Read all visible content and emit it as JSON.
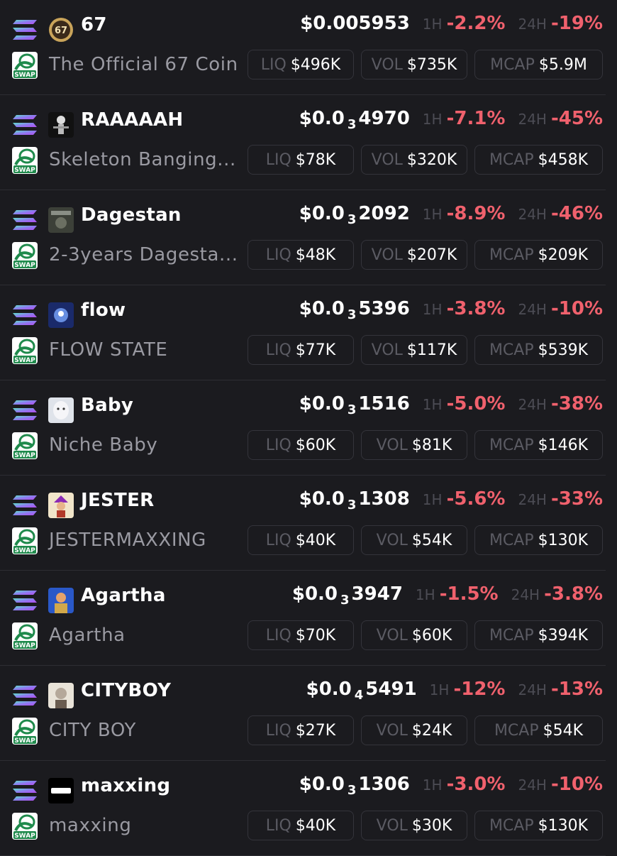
{
  "colors": {
    "background": "#1b1b1f",
    "negative": "#f0616d",
    "muted": "#9a9aa2",
    "label": "#4c4c54",
    "border": "#34343b"
  },
  "labels": {
    "h1": "1H",
    "h24": "24H",
    "liq": "LIQ",
    "vol": "VOL",
    "mcap": "MCAP",
    "swap": "SWAP"
  },
  "tokens": [
    {
      "symbol": "67",
      "name": "The Official 67 Coin",
      "price_main": "$0.005953",
      "price_zeros": "",
      "price_tail": "",
      "change_1h": "-2.2%",
      "change_24h": "-19%",
      "liq": "$496K",
      "vol": "$735K",
      "mcap": "$5.9M",
      "avatar_text": "67",
      "icon": "coin-67-icon"
    },
    {
      "symbol": "RAAAAAH",
      "name": "Skeleton Banging...",
      "price_main": "$0.0",
      "price_zeros": "3",
      "price_tail": "4970",
      "change_1h": "-7.1%",
      "change_24h": "-45%",
      "liq": "$78K",
      "vol": "$320K",
      "mcap": "$458K",
      "avatar_text": "",
      "icon": "skeleton-avatar-icon"
    },
    {
      "symbol": "Dagestan",
      "name": "2-3years Dagesta...",
      "price_main": "$0.0",
      "price_zeros": "3",
      "price_tail": "2092",
      "change_1h": "-8.9%",
      "change_24h": "-46%",
      "liq": "$48K",
      "vol": "$207K",
      "mcap": "$209K",
      "avatar_text": "",
      "icon": "dagestan-avatar-icon"
    },
    {
      "symbol": "flow",
      "name": "FLOW STATE",
      "price_main": "$0.0",
      "price_zeros": "3",
      "price_tail": "5396",
      "change_1h": "-3.8%",
      "change_24h": "-10%",
      "liq": "$77K",
      "vol": "$117K",
      "mcap": "$539K",
      "avatar_text": "",
      "icon": "flow-avatar-icon"
    },
    {
      "symbol": "Baby",
      "name": "Niche Baby",
      "price_main": "$0.0",
      "price_zeros": "3",
      "price_tail": "1516",
      "change_1h": "-5.0%",
      "change_24h": "-38%",
      "liq": "$60K",
      "vol": "$81K",
      "mcap": "$146K",
      "avatar_text": "",
      "icon": "baby-avatar-icon"
    },
    {
      "symbol": "JESTER",
      "name": "JESTERMAXXING",
      "price_main": "$0.0",
      "price_zeros": "3",
      "price_tail": "1308",
      "change_1h": "-5.6%",
      "change_24h": "-33%",
      "liq": "$40K",
      "vol": "$54K",
      "mcap": "$130K",
      "avatar_text": "",
      "icon": "jester-avatar-icon"
    },
    {
      "symbol": "Agartha",
      "name": "Agartha",
      "price_main": "$0.0",
      "price_zeros": "3",
      "price_tail": "3947",
      "change_1h": "-1.5%",
      "change_24h": "-3.8%",
      "liq": "$70K",
      "vol": "$60K",
      "mcap": "$394K",
      "avatar_text": "",
      "icon": "agartha-avatar-icon"
    },
    {
      "symbol": "CITYBOY",
      "name": "CITY BOY",
      "price_main": "$0.0",
      "price_zeros": "4",
      "price_tail": "5491",
      "change_1h": "-12%",
      "change_24h": "-13%",
      "liq": "$27K",
      "vol": "$24K",
      "mcap": "$54K",
      "avatar_text": "",
      "icon": "cityboy-avatar-icon"
    },
    {
      "symbol": "maxxing",
      "name": "maxxing",
      "price_main": "$0.0",
      "price_zeros": "3",
      "price_tail": "1306",
      "change_1h": "-3.0%",
      "change_24h": "-10%",
      "liq": "$40K",
      "vol": "$30K",
      "mcap": "$130K",
      "avatar_text": "",
      "icon": "maxxing-avatar-icon"
    }
  ]
}
